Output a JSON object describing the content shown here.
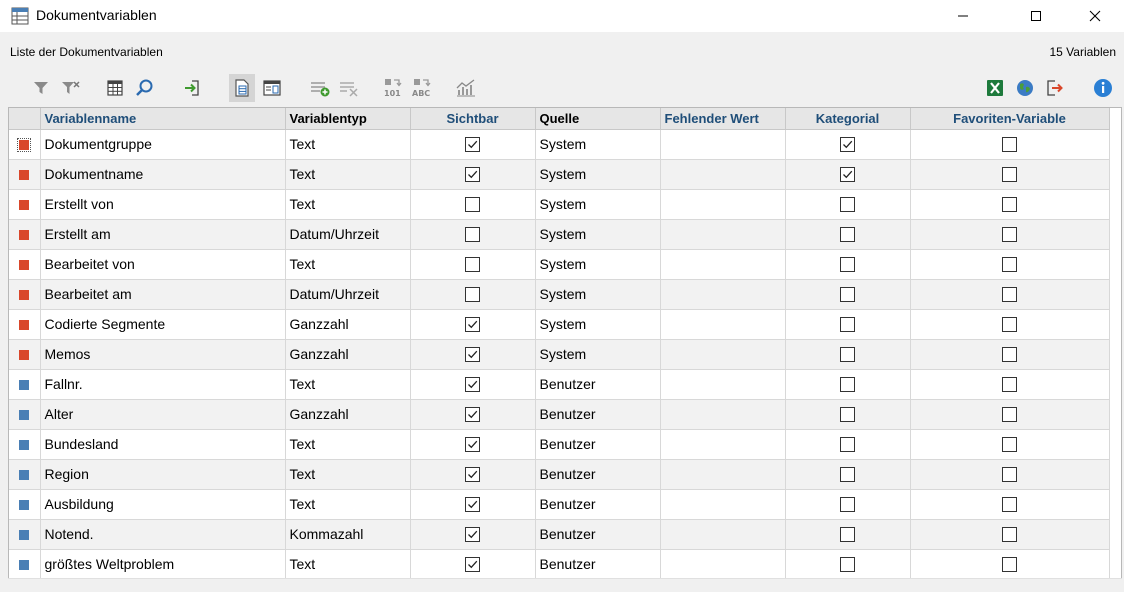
{
  "window": {
    "title": "Dokumentvariablen"
  },
  "info": {
    "list_label": "Liste der Dokumentvariablen",
    "count": "15 Variablen"
  },
  "toolbar": {
    "left_icons": [
      "filter-icon",
      "clear-filter-icon",
      "table-icon",
      "search-icon",
      "import-icon",
      "document-variables-icon",
      "list-view-icon",
      "add-variable-icon",
      "delete-variable-icon",
      "convert-numeric-icon",
      "convert-text-icon",
      "statistics-icon"
    ],
    "right_icons": [
      "excel-icon",
      "globe-icon",
      "export-icon",
      "info-icon"
    ]
  },
  "colors": {
    "system": "#d9472b",
    "user": "#4a7fb5",
    "header_blue": "#1f4e79"
  },
  "table": {
    "columns": [
      "Variablenname",
      "Variablentyp",
      "Sichtbar",
      "Quelle",
      "Fehlender Wert",
      "Kategorial",
      "Favoriten-Variable"
    ],
    "rows": [
      {
        "source_type": "system",
        "name": "Dokumentgruppe",
        "type": "Text",
        "visible": true,
        "source": "System",
        "missing": "",
        "categorical": true,
        "favorite": false
      },
      {
        "source_type": "system",
        "name": "Dokumentname",
        "type": "Text",
        "visible": true,
        "source": "System",
        "missing": "",
        "categorical": true,
        "favorite": false
      },
      {
        "source_type": "system",
        "name": "Erstellt von",
        "type": "Text",
        "visible": false,
        "source": "System",
        "missing": "",
        "categorical": false,
        "favorite": false
      },
      {
        "source_type": "system",
        "name": "Erstellt am",
        "type": "Datum/Uhrzeit",
        "visible": false,
        "source": "System",
        "missing": "",
        "categorical": false,
        "favorite": false
      },
      {
        "source_type": "system",
        "name": "Bearbeitet von",
        "type": "Text",
        "visible": false,
        "source": "System",
        "missing": "",
        "categorical": false,
        "favorite": false
      },
      {
        "source_type": "system",
        "name": "Bearbeitet am",
        "type": "Datum/Uhrzeit",
        "visible": false,
        "source": "System",
        "missing": "",
        "categorical": false,
        "favorite": false
      },
      {
        "source_type": "system",
        "name": "Codierte Segmente",
        "type": "Ganzzahl",
        "visible": true,
        "source": "System",
        "missing": "",
        "categorical": false,
        "favorite": false
      },
      {
        "source_type": "system",
        "name": "Memos",
        "type": "Ganzzahl",
        "visible": true,
        "source": "System",
        "missing": "",
        "categorical": false,
        "favorite": false
      },
      {
        "source_type": "user",
        "name": "Fallnr.",
        "type": "Text",
        "visible": true,
        "source": "Benutzer",
        "missing": "",
        "categorical": false,
        "favorite": false
      },
      {
        "source_type": "user",
        "name": "Alter",
        "type": "Ganzzahl",
        "visible": true,
        "source": "Benutzer",
        "missing": "",
        "categorical": false,
        "favorite": false
      },
      {
        "source_type": "user",
        "name": "Bundesland",
        "type": "Text",
        "visible": true,
        "source": "Benutzer",
        "missing": "",
        "categorical": false,
        "favorite": false
      },
      {
        "source_type": "user",
        "name": "Region",
        "type": "Text",
        "visible": true,
        "source": "Benutzer",
        "missing": "",
        "categorical": false,
        "favorite": false
      },
      {
        "source_type": "user",
        "name": "Ausbildung",
        "type": "Text",
        "visible": true,
        "source": "Benutzer",
        "missing": "",
        "categorical": false,
        "favorite": false
      },
      {
        "source_type": "user",
        "name": "Notend.",
        "type": "Kommazahl",
        "visible": true,
        "source": "Benutzer",
        "missing": "",
        "categorical": false,
        "favorite": false
      },
      {
        "source_type": "user",
        "name": "größtes Weltproblem",
        "type": "Text",
        "visible": true,
        "source": "Benutzer",
        "missing": "",
        "categorical": false,
        "favorite": false
      }
    ]
  }
}
